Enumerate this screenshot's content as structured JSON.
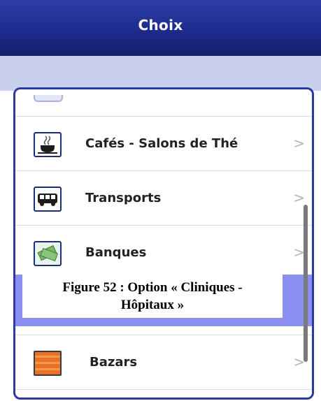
{
  "header": {
    "title": "Choix"
  },
  "list": {
    "items": [
      {
        "label": "Cafés - Salons de Thé",
        "icon": "coffee-cup-icon"
      },
      {
        "label": "Transports",
        "icon": "bus-icon"
      },
      {
        "label": "Banques",
        "icon": "money-icon"
      },
      {
        "label": "Bazars",
        "icon": "bazar-icon"
      }
    ],
    "chevron": ">"
  },
  "caption": {
    "line1": "Figure 52 : Option « Cliniques -",
    "line2": "Hôpitaux »"
  },
  "colors": {
    "header": "#1d2b8c",
    "highlight": "#8a8ff0",
    "frame": "#2a3aa0"
  }
}
